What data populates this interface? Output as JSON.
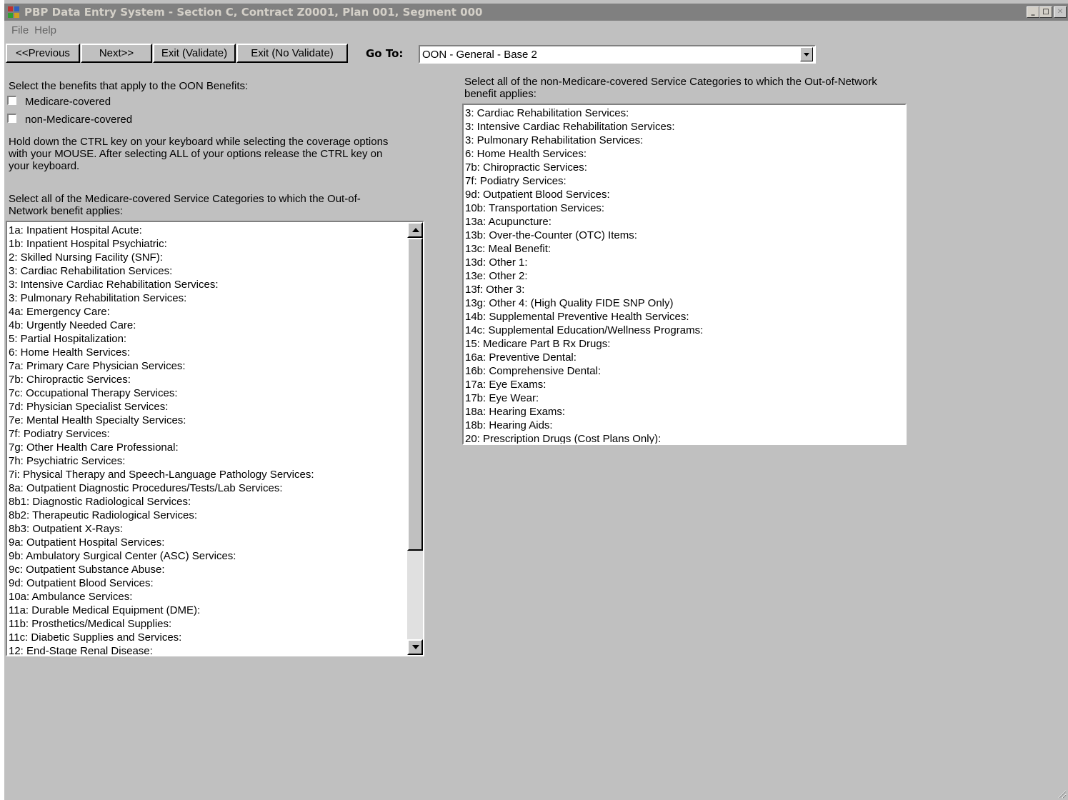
{
  "window": {
    "title": "PBP Data Entry System - Section C, Contract Z0001, Plan 001, Segment 000",
    "controls": {
      "minimize": "_",
      "restore": "□",
      "close": "✕"
    }
  },
  "menu": [
    "File",
    "Help"
  ],
  "toolbar": {
    "previous": "<<Previous",
    "next": "Next>>",
    "exit_validate": "Exit (Validate)",
    "exit_no_validate": "Exit (No Validate)",
    "goto_label": "Go To:",
    "goto_value": "OON - General - Base 2"
  },
  "benefits": {
    "prompt": "Select the benefits that apply to the OON Benefits:",
    "options": [
      {
        "label": "Medicare-covered",
        "checked": false
      },
      {
        "label": "non-Medicare-covered",
        "checked": false
      }
    ]
  },
  "instructions": {
    "line1": "Hold down the CTRL key on your keyboard while selecting the coverage options",
    "line2": "with your MOUSE. After selecting ALL of your options release the CTRL key on",
    "line3": "your keyboard."
  },
  "medicare_list": {
    "prompt_line1": "Select all of the Medicare-covered Service Categories to which the Out-of-",
    "prompt_line2": "Network benefit applies:",
    "items": [
      "1a: Inpatient Hospital Acute:",
      "1b: Inpatient Hospital Psychiatric:",
      "2: Skilled Nursing Facility (SNF):",
      "3: Cardiac Rehabilitation Services:",
      "3: Intensive Cardiac Rehabilitation Services:",
      "3: Pulmonary Rehabilitation Services:",
      "4a: Emergency Care:",
      "4b: Urgently Needed Care:",
      "5: Partial Hospitalization:",
      "6: Home Health Services:",
      "7a: Primary Care Physician Services:",
      "7b: Chiropractic Services:",
      "7c: Occupational Therapy Services:",
      "7d: Physician Specialist Services:",
      "7e: Mental Health Specialty Services:",
      "7f: Podiatry Services:",
      "7g: Other Health Care Professional:",
      "7h: Psychiatric Services:",
      "7i: Physical Therapy and Speech-Language Pathology Services:",
      "8a: Outpatient Diagnostic Procedures/Tests/Lab Services:",
      "8b1: Diagnostic Radiological Services:",
      "8b2: Therapeutic Radiological Services:",
      "8b3: Outpatient X-Rays:",
      "9a: Outpatient Hospital Services:",
      "9b: Ambulatory Surgical Center (ASC) Services:",
      "9c: Outpatient Substance Abuse:",
      "9d: Outpatient Blood Services:",
      "10a: Ambulance Services:",
      "11a: Durable Medical Equipment (DME):",
      "11b: Prosthetics/Medical Supplies:",
      "11c: Diabetic Supplies and Services:",
      "12: End-Stage Renal Disease:"
    ]
  },
  "non_medicare_list": {
    "prompt_line1": "Select all of the non-Medicare-covered Service Categories to which the Out-of-Network",
    "prompt_line2": "benefit applies:",
    "items": [
      "3: Cardiac Rehabilitation Services:",
      "3: Intensive Cardiac Rehabilitation Services:",
      "3: Pulmonary Rehabilitation Services:",
      "6: Home Health Services:",
      "7b: Chiropractic Services:",
      "7f: Podiatry Services:",
      "9d: Outpatient Blood Services:",
      "10b: Transportation Services:",
      "13a: Acupuncture:",
      "13b: Over-the-Counter (OTC) Items:",
      "13c: Meal Benefit:",
      "13d: Other 1:",
      "13e: Other 2:",
      "13f: Other 3:",
      "13g: Other 4: (High Quality FIDE SNP Only)",
      "14b: Supplemental Preventive Health Services:",
      "14c: Supplemental Education/Wellness Programs:",
      "15: Medicare Part B Rx Drugs:",
      "16a: Preventive Dental:",
      "16b: Comprehensive Dental:",
      "17a: Eye Exams:",
      "17b: Eye Wear:",
      "18a: Hearing Exams:",
      "18b: Hearing Aids:",
      "20: Prescription Drugs (Cost Plans Only):"
    ]
  }
}
